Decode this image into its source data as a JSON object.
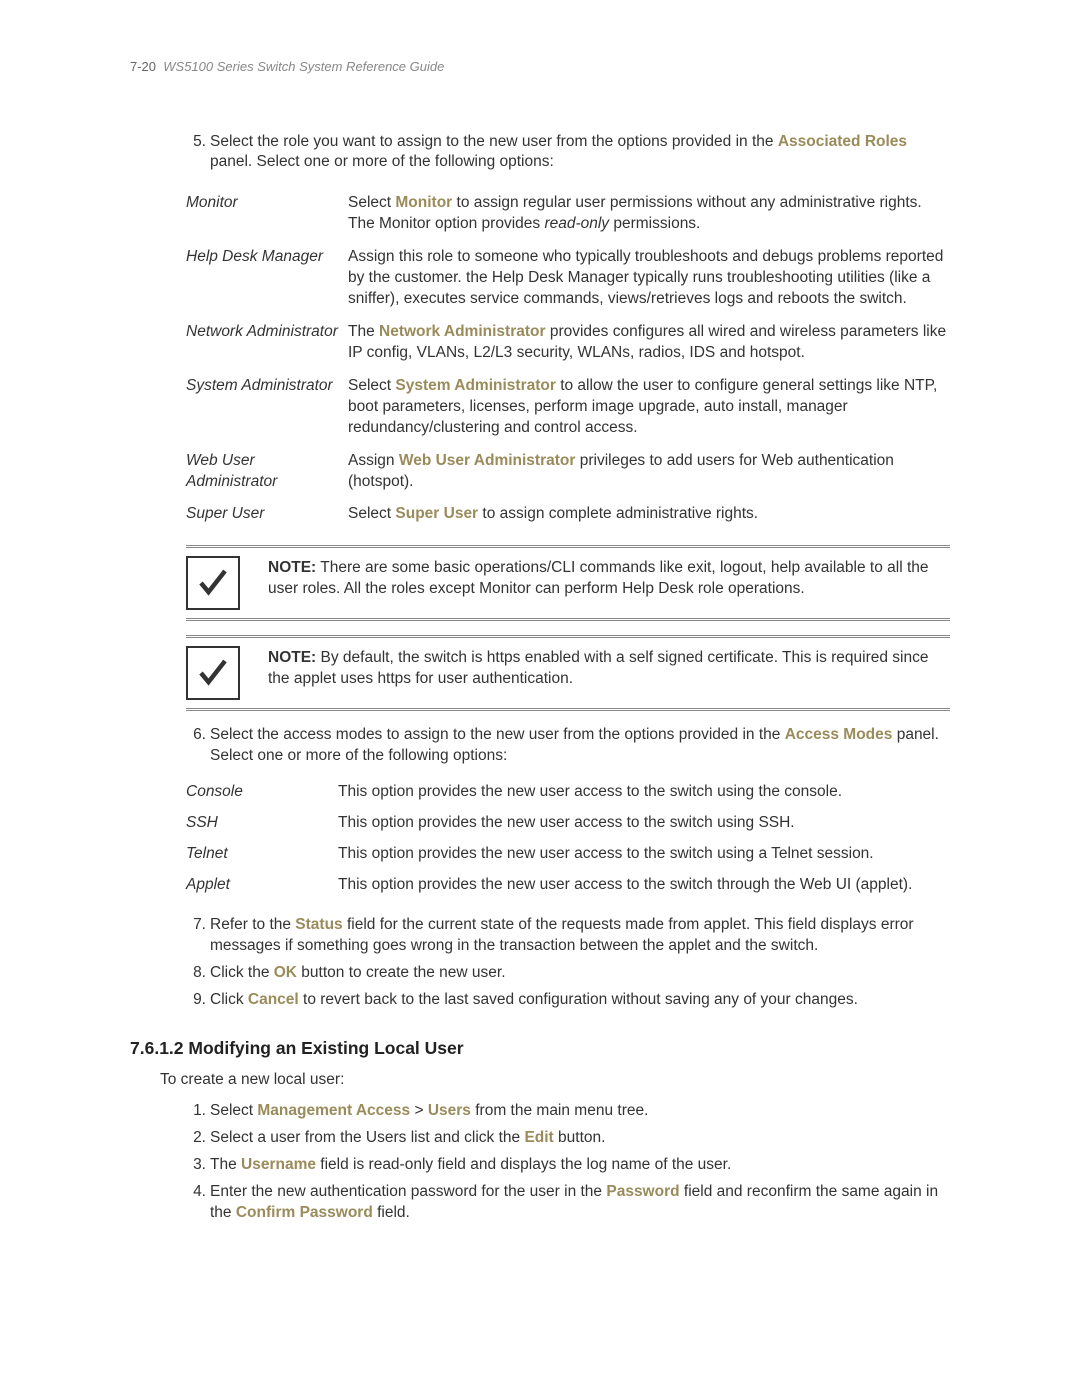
{
  "header": {
    "page_num": "7-20",
    "title": "WS5100 Series Switch System Reference Guide"
  },
  "step5": {
    "num": "5.",
    "text_before": "Select the role you want to assign to the new user from the options provided in the ",
    "link": "Associated Roles",
    "text_after": " panel. Select one or more of the following options:"
  },
  "roles": {
    "monitor": {
      "term": "Monitor",
      "p1": "Select ",
      "link": "Monitor",
      "p2": " to assign regular user permissions without any administrative rights. The Monitor option provides ",
      "italic": "read-only",
      "p3": " permissions."
    },
    "helpdesk": {
      "term": "Help Desk Manager",
      "desc": "Assign this role to someone who typically troubleshoots and debugs problems reported by the customer. the Help Desk Manager typically runs troubleshooting utilities (like a sniffer), executes service commands, views/retrieves logs and reboots the switch."
    },
    "netadmin": {
      "term": "Network Administrator",
      "p1": "The ",
      "link": "Network Administrator",
      "p2": " provides configures all wired and wireless parameters like IP config, VLANs, L2/L3 security, WLANs, radios, IDS and hotspot."
    },
    "sysadmin": {
      "term": "System Administrator",
      "p1": "Select ",
      "link": "System Administrator",
      "p2": " to allow the user to configure general settings like NTP, boot parameters, licenses, perform image upgrade, auto install, manager redundancy/clustering and control access."
    },
    "webadmin": {
      "term": "Web User Administrator",
      "p1": "Assign ",
      "link": "Web User Administrator",
      "p2": " privileges to add users for Web authentication (hotspot)."
    },
    "superuser": {
      "term": "Super User",
      "p1": "Select ",
      "link": "Super User",
      "p2": " to assign complete administrative rights."
    }
  },
  "note1": {
    "label": "NOTE:",
    "text": " There are some basic operations/CLI commands like exit, logout, help available to all the user roles. All the roles except Monitor can perform Help Desk role operations."
  },
  "note2": {
    "label": "NOTE:",
    "text": " By default, the switch is https enabled with a self signed certificate. This is required since the applet uses https for user authentication."
  },
  "step6": {
    "num": "6.",
    "text_before": "Select the access modes to assign to the new user from the options provided in the ",
    "link": "Access Modes",
    "text_after": " panel. Select one or more of the following options:"
  },
  "access": {
    "console": {
      "term": "Console",
      "desc": "This option provides the new user access to the switch using the console."
    },
    "ssh": {
      "term": "SSH",
      "desc": "This option provides the new user access to the switch using SSH."
    },
    "telnet": {
      "term": "Telnet",
      "desc": "This option provides the new user access to the switch using a Telnet session."
    },
    "applet": {
      "term": "Applet",
      "desc": "This option provides the new user access to the switch through the Web UI (applet)."
    }
  },
  "step7": {
    "num": "7.",
    "p1": "Refer to the ",
    "link": "Status",
    "p2": " field for the current state of the requests made from applet. This field displays error messages if something goes wrong in the transaction between the applet and the switch."
  },
  "step8": {
    "num": "8.",
    "p1": "Click the ",
    "link": "OK",
    "p2": " button to create the new user."
  },
  "step9": {
    "num": "9.",
    "p1": "Click ",
    "link": "Cancel",
    "p2": " to revert back to the last saved configuration without saving any of your changes."
  },
  "section_heading": "7.6.1.2  Modifying an Existing Local User",
  "section_intro": "To create a new local user:",
  "mstep1": {
    "num": "1.",
    "p1": "Select ",
    "link1": "Management Access",
    "gt": " > ",
    "link2": "Users",
    "p2": " from the main menu tree."
  },
  "mstep2": {
    "num": "2.",
    "p1": "Select a user from the Users list and click the ",
    "link": "Edit",
    "p2": " button."
  },
  "mstep3": {
    "num": "3.",
    "p1": "The ",
    "link": "Username",
    "p2": " field is read-only field and displays the log name of the user."
  },
  "mstep4": {
    "num": "4.",
    "p1": "Enter the new authentication password for the user in the ",
    "link1": "Password",
    "p2": " field and reconfirm the same again in the ",
    "link2": "Confirm Password",
    "p3": " field."
  }
}
